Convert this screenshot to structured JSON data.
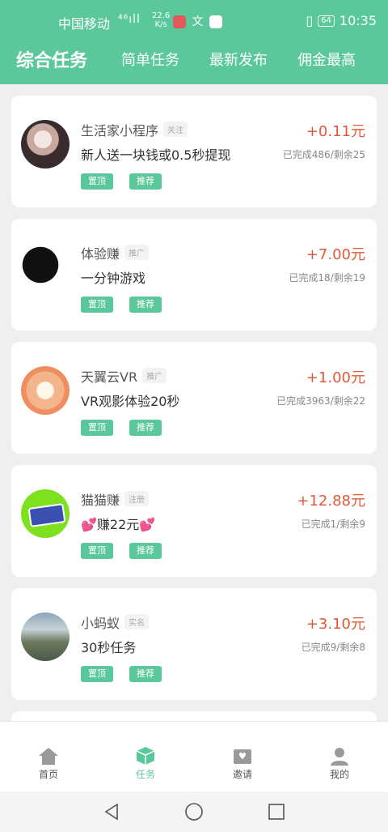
{
  "status_bar": {
    "carrier": "中国移动",
    "signal": "⁴⁶ıll",
    "speed_top": "22.6",
    "speed_bottom": "K/s",
    "battery": "64",
    "time": "10:35"
  },
  "tabs": [
    {
      "label": "综合任务",
      "active": true
    },
    {
      "label": "简单任务",
      "active": false
    },
    {
      "label": "最新发布",
      "active": false
    },
    {
      "label": "佣金最高",
      "active": false
    }
  ],
  "tasks": [
    {
      "name": "生活家小程序",
      "tag": "关注",
      "desc": "新人送一块钱或0.5秒提现",
      "reward": "+0.11元",
      "progress": "已完成486/剩余25",
      "btn_top": "置顶",
      "btn_rec": "推荐",
      "avatar": "person-photo"
    },
    {
      "name": "体验赚",
      "tag": "推广",
      "desc": "一分钟游戏",
      "reward": "+7.00元",
      "progress": "已完成18/剩余19",
      "btn_top": "置顶",
      "btn_rec": "推荐",
      "avatar": "dark-photo"
    },
    {
      "name": "天翼云VR",
      "tag": "推广",
      "desc": "VR观影体验20秒",
      "reward": "+1.00元",
      "progress": "已完成3963/剩余22",
      "btn_top": "置顶",
      "btn_rec": "推荐",
      "avatar": "cartoon-face"
    },
    {
      "name": "猫猫赚",
      "tag": "注册",
      "desc": "💕赚22元💕",
      "reward": "+12.88元",
      "progress": "已完成1/剩余9",
      "btn_top": "置顶",
      "btn_rec": "推荐",
      "avatar": "green-logo"
    },
    {
      "name": "小蚂蚁",
      "tag": "实名",
      "desc": "30秒任务",
      "reward": "+3.10元",
      "progress": "已完成9/剩余8",
      "btn_top": "置顶",
      "btn_rec": "推荐",
      "avatar": "landscape-photo"
    }
  ],
  "bottom_nav": [
    {
      "label": "首页",
      "icon": "home-icon",
      "active": false
    },
    {
      "label": "任务",
      "icon": "task-cube-icon",
      "active": true
    },
    {
      "label": "邀请",
      "icon": "invite-heart-icon",
      "active": false
    },
    {
      "label": "我的",
      "icon": "profile-icon",
      "active": false
    }
  ],
  "colors": {
    "accent": "#5bc89c",
    "reward": "#e05a3a"
  }
}
